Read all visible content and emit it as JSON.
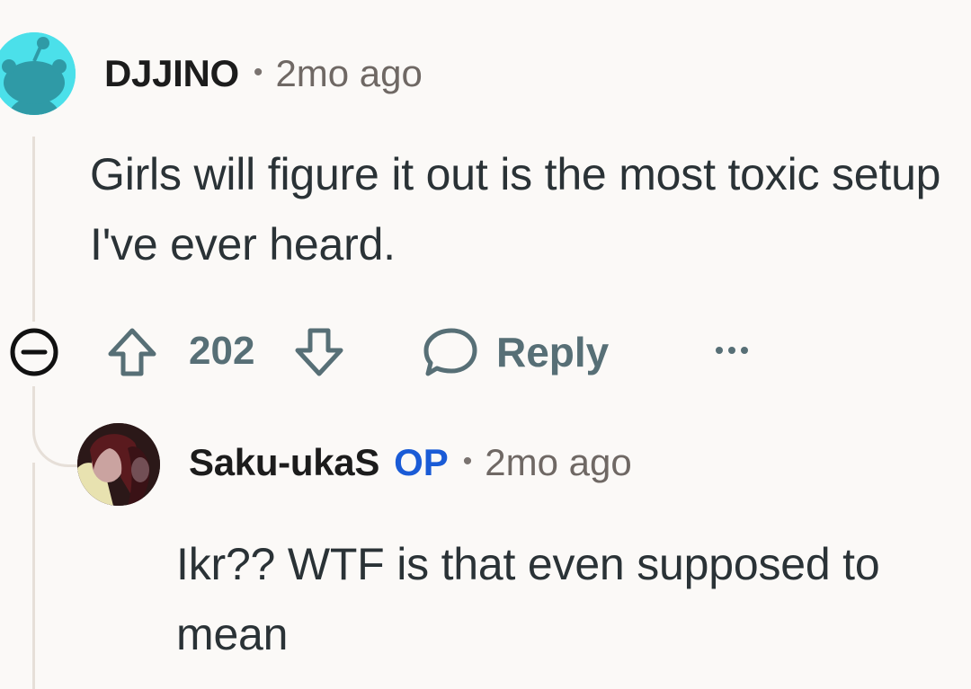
{
  "comments": [
    {
      "username": "DJJINO",
      "separator": "•",
      "timestamp": "2mo ago",
      "body": "Girls will figure it out is the most toxic setup I've ever heard.",
      "score": "202",
      "reply_label": "Reply",
      "avatar_color": "#4be0ea"
    },
    {
      "username": "Saku-ukaS",
      "op_badge": "OP",
      "separator": "•",
      "timestamp": "2mo ago",
      "body": "Ikr?? WTF is that even supposed to mean"
    }
  ],
  "colors": {
    "background": "#fbf9f7",
    "action_gray": "#576f76",
    "op_blue": "#1a5bd6",
    "thread_line": "#e6dfd8"
  },
  "icons": [
    "collapse-minus-icon",
    "upvote-arrow-icon",
    "downvote-arrow-icon",
    "reply-bubble-icon",
    "more-options-icon"
  ]
}
